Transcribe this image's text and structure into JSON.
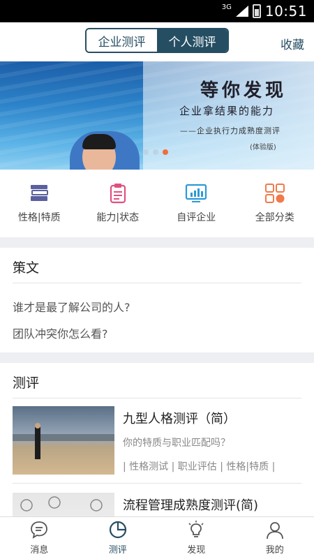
{
  "status_bar": {
    "network": "3G",
    "time": "10:51"
  },
  "header": {
    "segments": [
      "企业测评",
      "个人测评"
    ],
    "active_segment": "个人测评",
    "favorite_label": "收藏"
  },
  "banner": {
    "headline": "等你发现",
    "subline": "企业拿结果的能力",
    "caption": "——企业执行力成熟度测评",
    "version": "(体验版)",
    "active_dot": 3
  },
  "categories": [
    {
      "label": "性格|特质",
      "icon": "books-icon",
      "color": "#5a5f9e"
    },
    {
      "label": "能力|状态",
      "icon": "clipboard-icon",
      "color": "#e0507e"
    },
    {
      "label": "自评企业",
      "icon": "monitor-chart-icon",
      "color": "#2c9ad6"
    },
    {
      "label": "全部分类",
      "icon": "grid-icon",
      "color": "#f07a4b"
    }
  ],
  "articles_section": {
    "title": "策文",
    "items": [
      "谁才是最了解公司的人?",
      "团队冲突你怎么看?"
    ]
  },
  "assessment_section": {
    "title": "测评",
    "items": [
      {
        "title": "九型人格测评（简）",
        "desc": "你的特质与职业匹配吗？",
        "tags": "| 性格测试 | 职业评估 | 性格|特质 |"
      },
      {
        "title": "流程管理成熟度测评(简)",
        "desc": "",
        "tags": ""
      }
    ]
  },
  "tabbar": {
    "items": [
      {
        "label": "消息",
        "icon": "message-icon"
      },
      {
        "label": "测评",
        "icon": "pie-chart-icon"
      },
      {
        "label": "发现",
        "icon": "lightbulb-icon"
      },
      {
        "label": "我的",
        "icon": "user-icon"
      }
    ],
    "active": "测评"
  }
}
